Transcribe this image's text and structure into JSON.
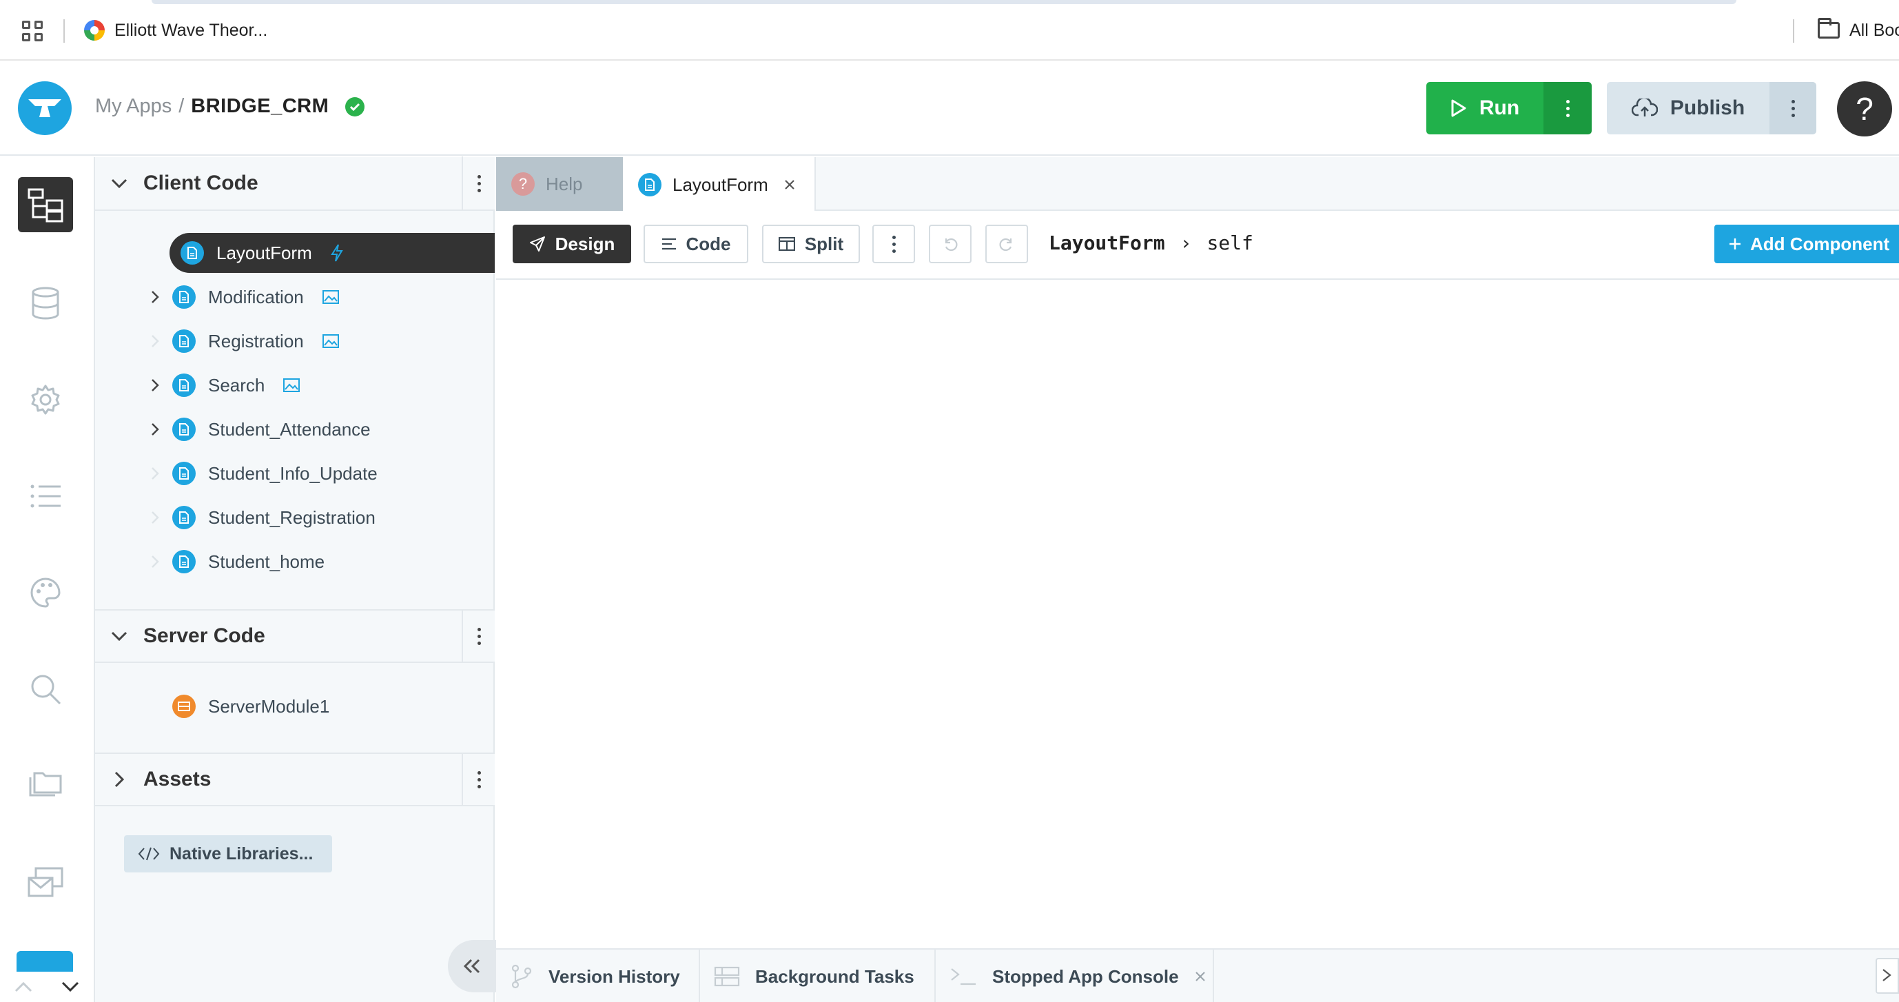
{
  "browser": {
    "bookmark_label": "Elliott Wave Theor...",
    "all_bookmarks_label": "All Boo"
  },
  "header": {
    "breadcrumb_root": "My Apps",
    "breadcrumb_sep": "/",
    "app_name": "BRIDGE_CRM",
    "run_label": "Run",
    "publish_label": "Publish",
    "help_label": "?"
  },
  "colors": {
    "accent": "#1ea5e0",
    "run_green": "#21b14b",
    "dark": "#333333",
    "server_orange": "#f08a2c"
  },
  "explorer": {
    "client_code": {
      "title": "Client Code",
      "forms": [
        {
          "name": "LayoutForm",
          "selected": true,
          "has_children": false,
          "badge": "bolt-icon"
        },
        {
          "name": "Modification",
          "has_children": true,
          "badge": "image-icon"
        },
        {
          "name": "Registration",
          "has_children": false,
          "badge": "image-icon"
        },
        {
          "name": "Search",
          "has_children": true,
          "badge": "image-icon"
        },
        {
          "name": "Student_Attendance",
          "has_children": true,
          "badge": ""
        },
        {
          "name": "Student_Info_Update",
          "has_children": false,
          "badge": ""
        },
        {
          "name": "Student_Registration",
          "has_children": false,
          "badge": ""
        },
        {
          "name": "Student_home",
          "has_children": false,
          "badge": ""
        }
      ]
    },
    "server_code": {
      "title": "Server Code",
      "modules": [
        {
          "name": "ServerModule1"
        }
      ]
    },
    "assets": {
      "title": "Assets"
    },
    "native_libraries_label": "Native Libraries..."
  },
  "editor": {
    "tabs": [
      {
        "label": "Help"
      },
      {
        "label": "LayoutForm"
      }
    ],
    "toolbar": {
      "design_label": "Design",
      "code_label": "Code",
      "split_label": "Split",
      "path_form": "LayoutForm",
      "path_sep": "›",
      "path_self": "self",
      "add_component_label": "Add Component"
    }
  },
  "bottom": {
    "version_history": "Version History",
    "background_tasks": "Background Tasks",
    "stopped_console": "Stopped App Console"
  }
}
